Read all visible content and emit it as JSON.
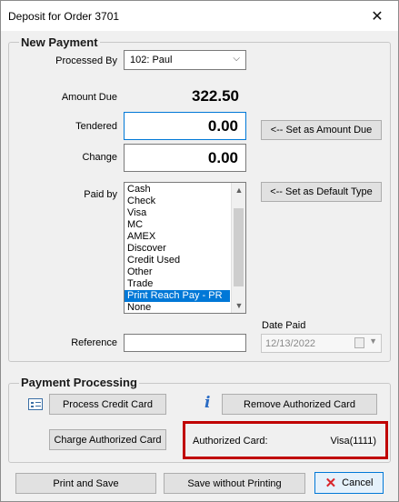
{
  "window": {
    "title": "Deposit for Order 3701",
    "close_glyph": "✕"
  },
  "new_payment": {
    "group_title": "New Payment",
    "processed_by_label": "Processed By",
    "processed_by_value": "102: Paul",
    "amount_due_label": "Amount Due",
    "amount_due_value": "322.50",
    "tendered_label": "Tendered",
    "tendered_value": "0.00",
    "change_label": "Change",
    "change_value": "0.00",
    "set_amount_due_button": "<-- Set as Amount Due",
    "paid_by_label": "Paid by",
    "set_default_type_button": "<-- Set as Default Type",
    "paid_by_options": [
      "Cash",
      "Check",
      "Visa",
      "MC",
      "AMEX",
      "Discover",
      "Credit Used",
      "Other",
      "Trade",
      "Print Reach Pay - PR",
      "None"
    ],
    "paid_by_selected": "Print Reach Pay - PR",
    "date_paid_label": "Date Paid",
    "date_paid_value": "12/13/2022",
    "reference_label": "Reference",
    "reference_value": ""
  },
  "payment_processing": {
    "group_title": "Payment Processing",
    "process_credit_card_button": "Process Credit Card",
    "remove_authorized_card_button": "Remove Authorized Card",
    "charge_authorized_card_button": "Charge Authorized Card",
    "authorized_card_label": "Authorized Card:",
    "authorized_card_value": "Visa(1111)",
    "info_icon": "i"
  },
  "footer": {
    "print_and_save_button": "Print and Save",
    "save_without_printing_button": "Save without Printing",
    "cancel_button": "Cancel",
    "cancel_icon": "✕"
  },
  "colors": {
    "highlight": "#c00000",
    "selection": "#0078d7",
    "cancel_icon": "#d9262c"
  }
}
